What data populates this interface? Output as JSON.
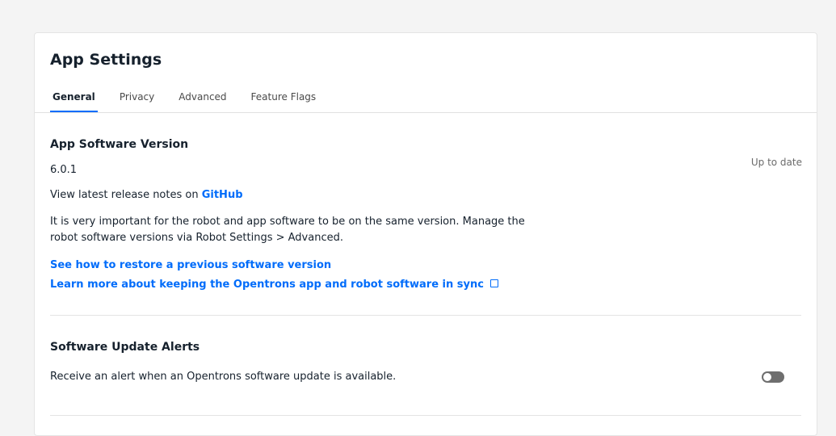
{
  "header": {
    "title": "App Settings",
    "tabs": [
      {
        "label": "General",
        "active": true
      },
      {
        "label": "Privacy",
        "active": false
      },
      {
        "label": "Advanced",
        "active": false
      },
      {
        "label": "Feature Flags",
        "active": false
      }
    ]
  },
  "software_version": {
    "title": "App Software Version",
    "version": "6.0.1",
    "status": "Up to date",
    "release_notes_prefix": "View latest release notes on ",
    "release_notes_link": "GitHub",
    "description_line1": "It is very important for the robot and app software to be on the same version. Manage the",
    "description_line2": "robot software versions via Robot Settings > Advanced.",
    "restore_link": "See how to restore a previous software version",
    "sync_link": "Learn more about keeping the Opentrons app and robot software in sync",
    "sync_link_icon": "external-link-icon"
  },
  "update_alerts": {
    "title": "Software Update Alerts",
    "description": "Receive an alert when an Opentrons software update is available.",
    "toggle_on": false
  },
  "colors": {
    "accent": "#006cfa",
    "toggle_off": "#6e6e6e"
  }
}
